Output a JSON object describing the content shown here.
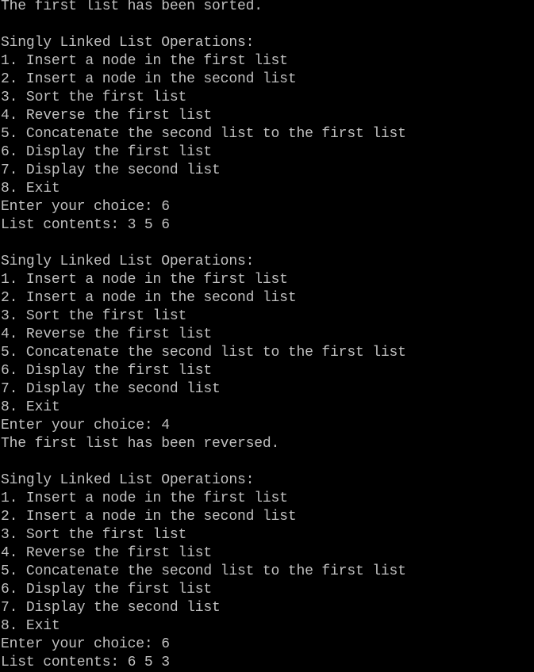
{
  "lines": [
    "The first list has been sorted.",
    "",
    "Singly Linked List Operations:",
    "1. Insert a node in the first list",
    "2. Insert a node in the second list",
    "3. Sort the first list",
    "4. Reverse the first list",
    "5. Concatenate the second list to the first list",
    "6. Display the first list",
    "7. Display the second list",
    "8. Exit",
    "Enter your choice: 6",
    "List contents: 3 5 6",
    "",
    "Singly Linked List Operations:",
    "1. Insert a node in the first list",
    "2. Insert a node in the second list",
    "3. Sort the first list",
    "4. Reverse the first list",
    "5. Concatenate the second list to the first list",
    "6. Display the first list",
    "7. Display the second list",
    "8. Exit",
    "Enter your choice: 4",
    "The first list has been reversed.",
    "",
    "Singly Linked List Operations:",
    "1. Insert a node in the first list",
    "2. Insert a node in the second list",
    "3. Sort the first list",
    "4. Reverse the first list",
    "5. Concatenate the second list to the first list",
    "6. Display the first list",
    "7. Display the second list",
    "8. Exit",
    "Enter your choice: 6",
    "List contents: 6 5 3"
  ]
}
